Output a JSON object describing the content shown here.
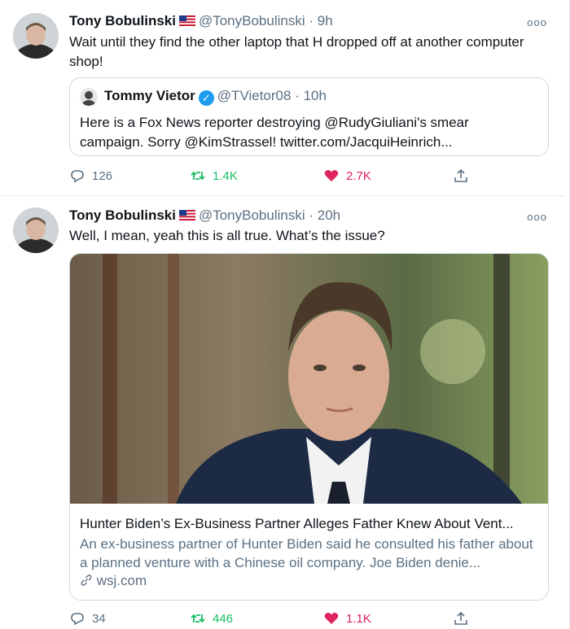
{
  "tweets": [
    {
      "name": "Tony Bobulinski",
      "flag": "us-flag-emoji",
      "handle": "@TonyBobulinski",
      "time": "· 9h",
      "text": "Wait until they find the other laptop that H dropped off at another computer shop!",
      "quote": {
        "name": "Tommy Vietor",
        "handle": "@TVietor08",
        "time": "· 10h",
        "text": "Here is a Fox News reporter destroying @RudyGiuliani's smear campaign. Sorry @KimStrassel! twitter.com/JacquiHeinrich..."
      },
      "replies": "126",
      "retweets": "1.4K",
      "likes": "2.7K"
    },
    {
      "name": "Tony Bobulinski",
      "flag": "us-flag-emoji",
      "handle": "@TonyBobulinski",
      "time": "· 20h",
      "text": "Well, I mean, yeah this is all true. What’s the issue?",
      "card": {
        "title": "Hunter Biden’s Ex-Business Partner Alleges Father Knew About Vent...",
        "description": "An ex-business partner of Hunter Biden said he consulted his father about a planned venture with a Chinese oil company. Joe Biden denie...",
        "domain": "wsj.com"
      },
      "replies": "34",
      "retweets": "446",
      "likes": "1.1K"
    }
  ],
  "more_glyph": "ooo",
  "colors": {
    "text": "#0f1419",
    "muted": "#5b7083",
    "retweet": "#17bf63",
    "like": "#e0245e",
    "verified": "#1d9bf0",
    "border": "#cfd9de"
  },
  "icons": [
    "reply-icon",
    "retweet-icon",
    "like-icon",
    "share-icon",
    "link-icon",
    "verified-icon",
    "more-icon"
  ]
}
